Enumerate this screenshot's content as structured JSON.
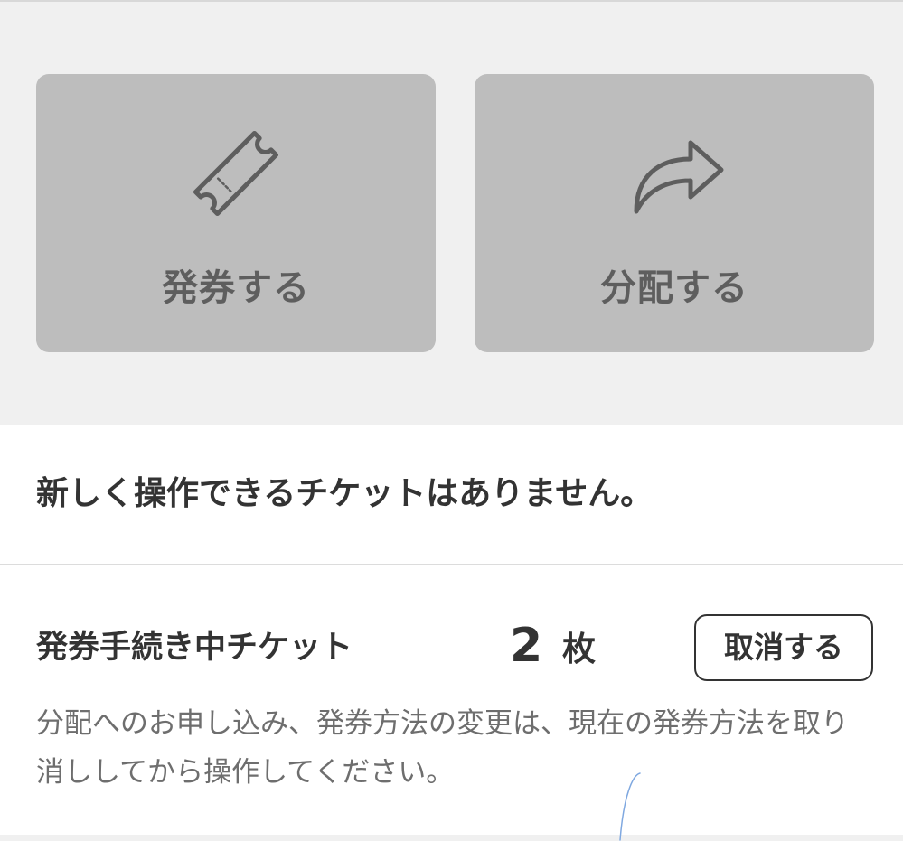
{
  "actions": {
    "issue": {
      "label": "発券する",
      "icon": "ticket-icon"
    },
    "distribute": {
      "label": "分配する",
      "icon": "share-arrow-icon"
    }
  },
  "empty_state": {
    "message": "新しく操作できるチケットはありません。"
  },
  "pending": {
    "title": "発券手続き中チケット",
    "count": "2",
    "unit": "枚",
    "cancel_label": "取消する",
    "note": "分配へのお申し込み、発券方法の変更は、現在の発券方法を取り消ししてから操作してください。"
  },
  "colors": {
    "panel_background": "#f0f0f0",
    "card_background": "#bdbdbd",
    "card_text": "#5e5e5e",
    "primary_text": "#333333",
    "secondary_text": "#6e6e6e"
  }
}
